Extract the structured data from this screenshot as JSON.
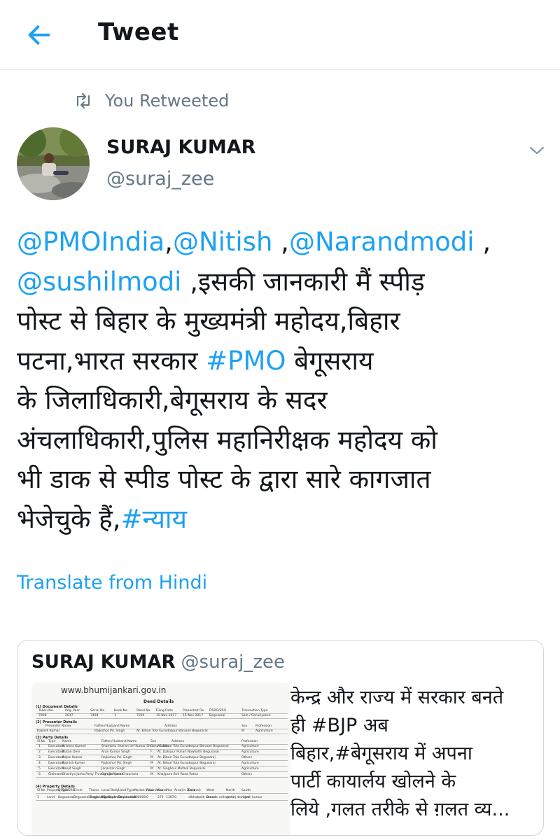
{
  "header": {
    "title": "Tweet",
    "back_icon": "arrow-left-icon"
  },
  "retweet": {
    "label": "You Retweeted",
    "icon": "retweet-icon"
  },
  "author": {
    "name": "SURAJ KUMAR",
    "handle": "@suraj_zee",
    "avatar_icon": "avatar-photo"
  },
  "menu": {
    "icon": "chevron-down-icon"
  },
  "tweet": {
    "lines": [
      [
        {
          "t": "@PMOIndia",
          "link": true
        },
        {
          "t": ","
        },
        {
          "t": "@Nitish",
          "link": true
        },
        {
          "t": " ,"
        },
        {
          "t": "@Narandmodi",
          "link": true
        },
        {
          "t": " ,"
        }
      ],
      [
        {
          "t": "@sushilmodi",
          "link": true
        },
        {
          "t": " ,इसकी जानकारी मैं स्पीड़"
        }
      ],
      [
        {
          "t": "पोस्ट से बिहार के मुख्यमंत्री महोदय,बिहार"
        }
      ],
      [
        {
          "t": "पटना,भारत सरकार "
        },
        {
          "t": "#PMO",
          "link": true
        },
        {
          "t": "  बेगूसराय"
        }
      ],
      [
        {
          "t": "के जिलाधिकारी,बेगूसराय के सदर"
        }
      ],
      [
        {
          "t": "अंचलाधिकारी,पुलिस महानिरीक्षक महोदय को"
        }
      ],
      [
        {
          "t": "भी डाक से स्पीड पोस्ट के द्वारा सारे कागजात"
        }
      ],
      [
        {
          "t": "भेजेचुके हैं,"
        },
        {
          "t": "#न्याय",
          "link": true
        }
      ]
    ]
  },
  "translate_label": "Translate from Hindi",
  "quote": {
    "name": "SURAJ KUMAR",
    "handle": "@suraj_zee",
    "lines": [
      "केन्द्र और राज्य में सरकार बनते",
      "ही #BJP अब",
      "बिहार,#बेगूसराय  में अपना",
      "पार्टी कायार्लय खोलने के",
      "लिये ,गलत तरीके से ग़लत व्य..."
    ],
    "image": {
      "url": "www.bhumijankari.gov.in",
      "title": "Deed Details",
      "sections": [
        "(1) Document Details",
        "(2) Presenter Details",
        "(3) Party Details",
        "(4) Property Details"
      ],
      "doc_headers": [
        "Token No.",
        "Reg. Year",
        "Serial No",
        "Book No.",
        "Deed No.",
        "Filing Date",
        "Presented On",
        "DSRO/SRO",
        "Transaction Type"
      ],
      "doc_values": [
        "7808",
        "2017",
        "7498",
        "1",
        "7295",
        "15-Nov-2017",
        "15-Nov-2017",
        "Begusarai",
        "Sale / Conveyance"
      ],
      "presenter_headers": [
        "Presenter Name",
        "Father/Husband Name",
        "Address",
        "Sex",
        "Profession"
      ],
      "presenter_values": [
        "Rajnish Kumar",
        "Rajkishor Pd. Singh",
        "At. Bihari Tola Gurudaspur Barauni Begusarai",
        "M",
        "Agriculture"
      ],
      "party_headers": [
        "Sl.No",
        "Type",
        "Name",
        "Father/Husband Name",
        "Sex",
        "Address",
        "Profession"
      ],
      "party_rows": [
        [
          "1",
          "Executant",
          "Krishna Kumari",
          "Shambhu Sharan Urf Kumar Shubhu Saran",
          "F",
          "At. Bihari Tola Gurudaspur Barauni Begusarai",
          "Agriculture"
        ],
        [
          "2",
          "Executant",
          "Nutan Devi",
          "Arun Kumar Singh",
          "F",
          "At. Dakrpur Puhari Nowkothi Begusarai",
          "Agriculture"
        ],
        [
          "3",
          "Executant",
          "Rajan Kumar",
          "Rajkishor Pd. Singh",
          "M",
          "At. Bihari Tola Gurudaspur Begusarai",
          "Others"
        ],
        [
          "4",
          "Executant",
          "Rajnish Kumar",
          "Rajkishor Pd. Singh",
          "M",
          "At. Bihari Tola Gurudaspur Begusarai",
          "Agriculture"
        ],
        [
          "5",
          "Executant",
          "Sanjit Singh",
          "Janardan Singh",
          "M",
          "At. Singhoul Mufasil Begusarai",
          "Agriculture"
        ],
        [
          "6",
          "Claimant",
          "Bhartiya Janta Party Through Sanjeev Chaurasia",
          "Ganga Prasad",
          "M",
          "Khajipura Beli Road Patna",
          "Others"
        ]
      ],
      "property_headers": [
        "Sl.No",
        "Property Type",
        "DSRO/SRO",
        "Circle",
        "Thana",
        "Local Body",
        "Land Type",
        "Market Value",
        "Final Value",
        "Khata",
        "Plot",
        "Area(in Decimal)",
        "East",
        "West",
        "North",
        "South"
      ],
      "property_values": [
        "1",
        "Land",
        "Begusarai",
        "Begusarai Nagar Nigam",
        "Singhoul-2, Chakhnd",
        "Municipal Corporation",
        "Residential",
        "600000",
        "0",
        "272",
        "1397",
        "0",
        "dibhabekh anand",
        "Brecsic college ki",
        "manoj devi bai",
        "rajesh kumar"
      ]
    }
  }
}
